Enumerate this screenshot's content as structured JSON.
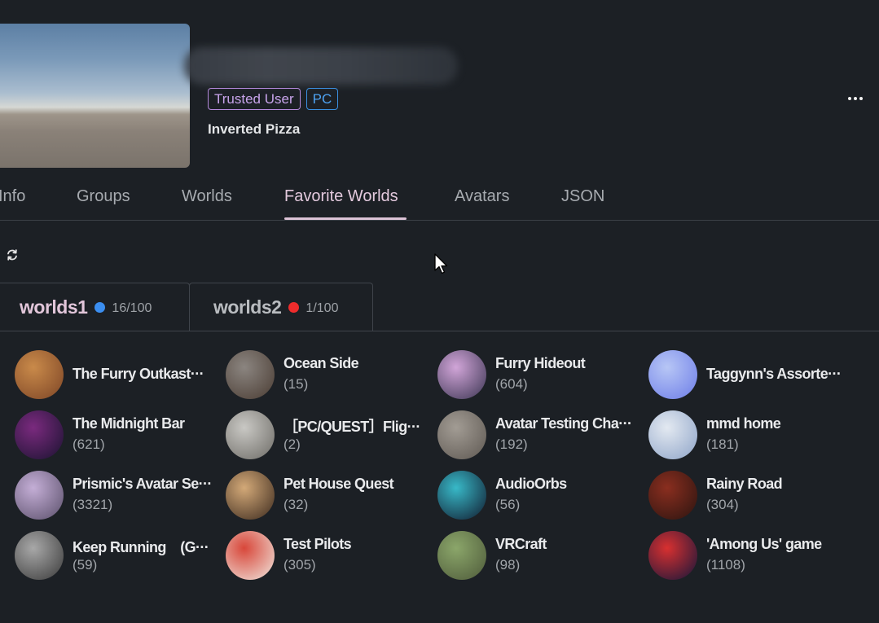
{
  "profile": {
    "badges": {
      "trusted": "Trusted User",
      "platform": "PC"
    },
    "status": "Inverted Pizza"
  },
  "tabs": [
    {
      "label": "Info",
      "active": false
    },
    {
      "label": "Groups",
      "active": false
    },
    {
      "label": "Worlds",
      "active": false
    },
    {
      "label": "Favorite Worlds",
      "active": true
    },
    {
      "label": "Avatars",
      "active": false
    },
    {
      "label": "JSON",
      "active": false
    }
  ],
  "groups": [
    {
      "name": "worlds1",
      "dot_color": "#3b8ef0",
      "count": "16/100",
      "active": true
    },
    {
      "name": "worlds2",
      "dot_color": "#ee2c2c",
      "count": "1/100",
      "active": false
    }
  ],
  "worlds": [
    {
      "name": "The Furry Outkast···",
      "count": "",
      "thumb": [
        "#c98a4a",
        "#7d4526"
      ]
    },
    {
      "name": "Ocean Side",
      "count": "(15)",
      "thumb": [
        "#8b8580",
        "#4a3c33"
      ]
    },
    {
      "name": "Furry Hideout",
      "count": "(604)",
      "thumb": [
        "#d1a5d8",
        "#3b3552"
      ]
    },
    {
      "name": "Taggynn's Assorte···",
      "count": "",
      "thumb": [
        "#b7c6f5",
        "#6d7de8"
      ]
    },
    {
      "name": "The Midnight Bar",
      "count": "(621)",
      "thumb": [
        "#7a2a7e",
        "#1a1330"
      ]
    },
    {
      "name": "［PC/QUEST］Flig···",
      "count": "(2)",
      "thumb": [
        "#c9c8c4",
        "#6d6b66"
      ]
    },
    {
      "name": "Avatar Testing Cha···",
      "count": "(192)",
      "thumb": [
        "#a29c94",
        "#5e5852"
      ]
    },
    {
      "name": "mmd home",
      "count": "(181)",
      "thumb": [
        "#e3e9f1",
        "#8ea4c8"
      ]
    },
    {
      "name": "Prismic's Avatar Se···",
      "count": "(3321)",
      "thumb": [
        "#c4aed6",
        "#5a4f6a"
      ]
    },
    {
      "name": "Pet House Quest",
      "count": "(32)",
      "thumb": [
        "#d3a978",
        "#3c2a1e"
      ]
    },
    {
      "name": "AudioOrbs",
      "count": "(56)",
      "thumb": [
        "#38b9c8",
        "#111a2e"
      ]
    },
    {
      "name": "Rainy Road",
      "count": "(304)",
      "thumb": [
        "#8a2e1f",
        "#2a1410"
      ]
    },
    {
      "name": "Keep Running　(G···",
      "count": "(59)",
      "thumb": [
        "#a8a8a8",
        "#3a3a3a"
      ]
    },
    {
      "name": "Test Pilots",
      "count": "(305)",
      "thumb": [
        "#d8473a",
        "#f0e8e0"
      ]
    },
    {
      "name": "VRCraft",
      "count": "(98)",
      "thumb": [
        "#8ba66a",
        "#4e5a3a"
      ]
    },
    {
      "name": "'Among Us' game",
      "count": "(1108)",
      "thumb": [
        "#d83030",
        "#13163a"
      ]
    }
  ],
  "icons": {
    "refresh": "refresh-icon",
    "more": "more-options-icon"
  }
}
